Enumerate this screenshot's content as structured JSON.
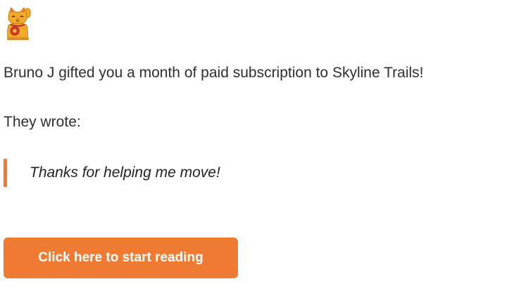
{
  "header": {
    "logo_icon": "beckoning-cat-icon"
  },
  "message": {
    "intro": "Bruno J gifted you a month of paid subscription to Skyline Trails!",
    "wrote_label": "They wrote:",
    "quote": "Thanks for helping me move!"
  },
  "cta": {
    "label": "Click here to start reading"
  },
  "colors": {
    "accent": "#ef7b33",
    "text": "#2f2f2f",
    "background": "#ffffff"
  }
}
